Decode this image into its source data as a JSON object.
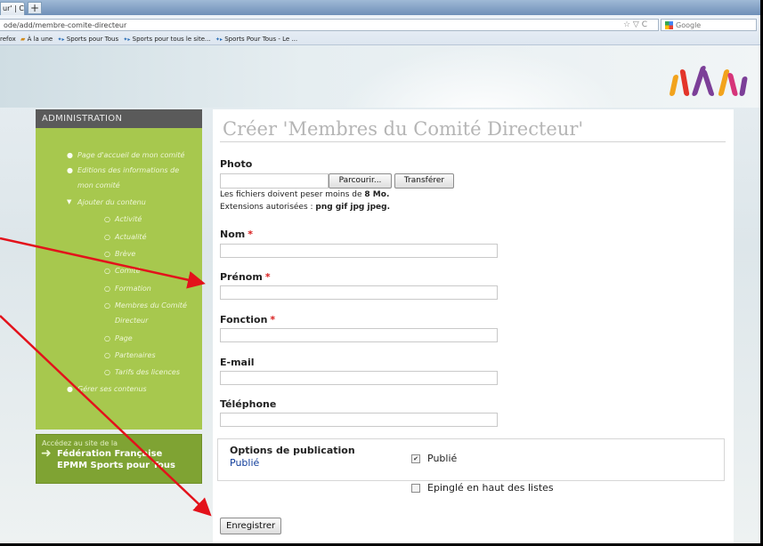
{
  "browser": {
    "tab_title": "ur' | C...",
    "newtab_label": "+",
    "url": "ode/add/membre-comite-directeur",
    "url_actions": "☆ ▽ C",
    "search_placeholder": "Google",
    "bookmarks": [
      {
        "icon": "folder-icon",
        "label": "refox"
      },
      {
        "icon": "folder-icon",
        "label": "À la une"
      },
      {
        "icon": "rss-icon",
        "label": "Sports pour Tous"
      },
      {
        "icon": "rss-icon",
        "label": "Sports pour tous le site..."
      },
      {
        "icon": "rss-icon",
        "label": "Sports Pour Tous - Le ..."
      }
    ]
  },
  "sidebar": {
    "title": "ADMINISTRATION",
    "items": [
      {
        "label": "Page d'accueil de mon comité",
        "level": 1
      },
      {
        "label": "Editions des informations de",
        "level": 1
      },
      {
        "label": "mon comité",
        "level": 1
      },
      {
        "label": "Ajouter du contenu",
        "level": 1
      },
      {
        "label": "Activité",
        "level": 2
      },
      {
        "label": "Actualité",
        "level": 2
      },
      {
        "label": "Brève",
        "level": 2
      },
      {
        "label": "Comité",
        "level": 2
      },
      {
        "label": "Formation",
        "level": 2
      },
      {
        "label": "Membres du Comité",
        "level": 2
      },
      {
        "label": "Directeur",
        "level": 2
      },
      {
        "label": "Page",
        "level": 2
      },
      {
        "label": "Partenaires",
        "level": 2
      },
      {
        "label": "Tarifs des licences",
        "level": 2
      },
      {
        "label": "Gérer ses contenus",
        "level": 1
      }
    ]
  },
  "promo": {
    "intro": "Accédez au site de la",
    "line1": "Fédération Française",
    "line2": "EPMM Sports pour Tous"
  },
  "form": {
    "title": "Créer 'Membres du Comité Directeur'",
    "photo_label": "Photo",
    "browse_label": "Parcourir...",
    "upload_label": "Transférer",
    "size_help_prefix": "Les fichiers doivent peser moins de ",
    "size_help_value": "8 Mo.",
    "ext_help_prefix": "Extensions autorisées : ",
    "ext_help_value": "png gif jpg jpeg.",
    "required_mark": "*",
    "nom_label": "Nom",
    "prenom_label": "Prénom",
    "fonction_label": "Fonction",
    "email_label": "E-mail",
    "telephone_label": "Téléphone",
    "nom_value": "",
    "prenom_value": "",
    "fonction_value": "",
    "email_value": "",
    "telephone_value": "",
    "publication": {
      "title": "Options de publication",
      "summary": "Publié",
      "published_label": "Publié",
      "published_checked": true,
      "sticky_label": "Epinglé en haut des listes",
      "sticky_checked": false
    },
    "submit_label": "Enregistrer"
  },
  "colors": {
    "sidebar_bg": "#a7c84e",
    "sidebar_title_bg": "#5a5a5a",
    "required": "#d81c1c",
    "link": "#0f3c9a",
    "annotation_arrow": "#e3121b"
  }
}
